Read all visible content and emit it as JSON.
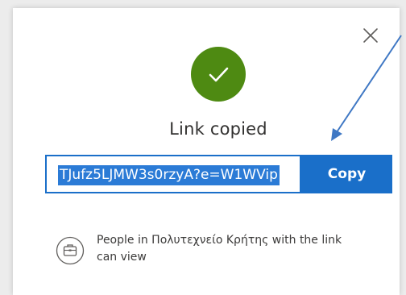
{
  "dialog": {
    "title": "Link copied",
    "link_value": "TJufz5LJMW3s0rzyA?e=W1WVip",
    "copy_label": "Copy",
    "permission_text": "People in Πολυτεχνείο Κρήτης with the link can view"
  },
  "icons": {
    "close": "close-icon",
    "success": "checkmark-icon",
    "permission": "briefcase-icon",
    "annotation": "annotation-arrow"
  },
  "colors": {
    "success_green": "#4e8a12",
    "primary_blue": "#1a6fc9",
    "selection_blue": "#2b7bd6",
    "annotation_arrow": "#3f78c4"
  }
}
